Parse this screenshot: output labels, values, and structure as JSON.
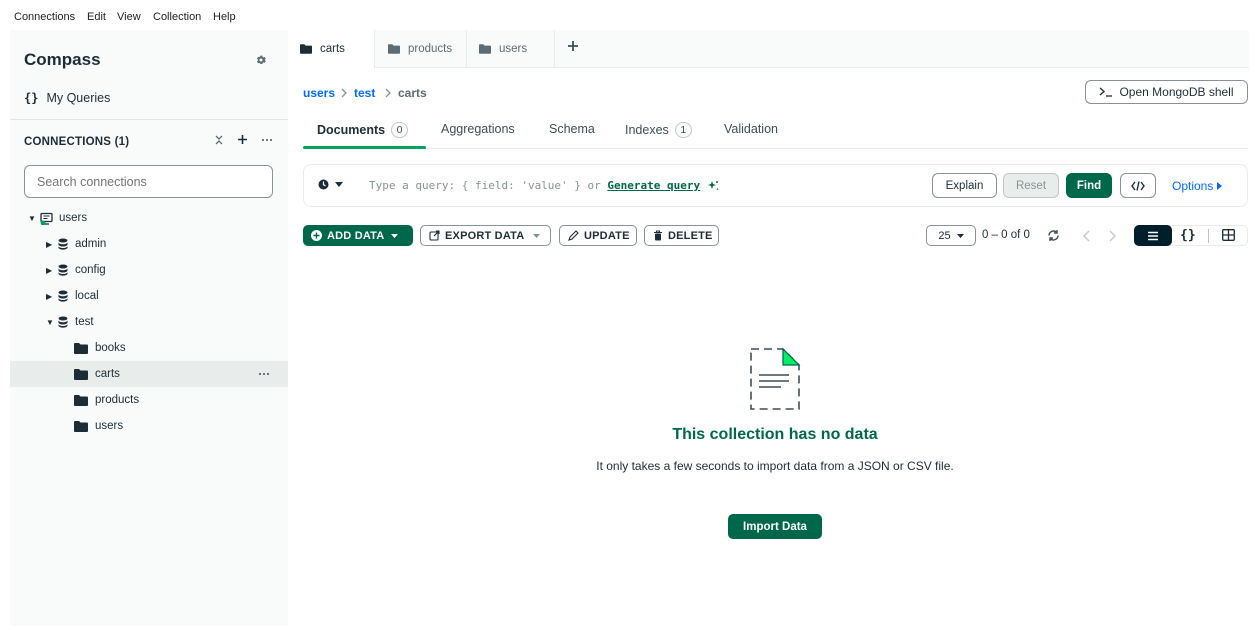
{
  "menubar": [
    "Connections",
    "Edit",
    "View",
    "Collection",
    "Help"
  ],
  "sidebar": {
    "title": "Compass",
    "my_queries": "My Queries",
    "connections_label": "CONNECTIONS (1)",
    "search_placeholder": "Search connections",
    "tree": {
      "connection": "users",
      "databases": [
        "admin",
        "config",
        "local",
        "test"
      ],
      "collections": [
        "books",
        "carts",
        "products",
        "users"
      ],
      "selected_collection": "carts"
    }
  },
  "tabs": [
    {
      "label": "carts",
      "active": true
    },
    {
      "label": "products",
      "active": false
    },
    {
      "label": "users",
      "active": false
    }
  ],
  "breadcrumb": [
    "users",
    "test",
    "carts"
  ],
  "shell_button": "Open MongoDB shell",
  "subtabs": {
    "documents": "Documents",
    "documents_count": "0",
    "aggregations": "Aggregations",
    "schema": "Schema",
    "indexes": "Indexes",
    "indexes_count": "1",
    "validation": "Validation"
  },
  "query": {
    "placeholder_prefix": "Type a query: { field: 'value' } or",
    "generate": "Generate query",
    "explain": "Explain",
    "reset": "Reset",
    "find": "Find",
    "options": "Options"
  },
  "toolbar": {
    "add_data": "ADD DATA",
    "export_data": "EXPORT DATA",
    "update": "UPDATE",
    "delete": "DELETE",
    "page_size": "25",
    "range": "0 – 0 of 0"
  },
  "empty": {
    "title": "This collection has no data",
    "text": "It only takes a few seconds to import data from a JSON or CSV file.",
    "button": "Import Data"
  },
  "colors": {
    "accent_green": "#00684a",
    "bright_green": "#00ed64",
    "link_blue": "#016bf8",
    "text": "#1c2d38"
  }
}
